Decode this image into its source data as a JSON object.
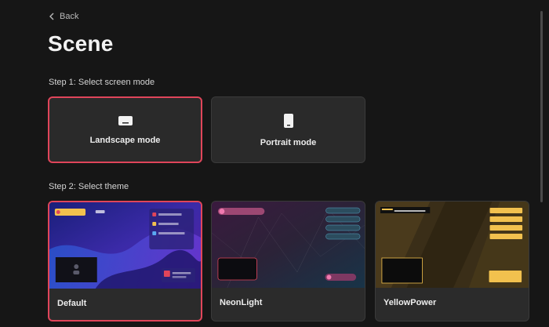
{
  "nav": {
    "back_label": "Back"
  },
  "page": {
    "title": "Scene"
  },
  "steps": {
    "step1_label": "Step 1: Select screen mode",
    "step2_label": "Step 2: Select theme"
  },
  "screen_modes": [
    {
      "label": "Landscape mode",
      "icon": "landscape-device-icon",
      "selected": true
    },
    {
      "label": "Portrait mode",
      "icon": "portrait-device-icon",
      "selected": false
    }
  ],
  "themes": [
    {
      "name": "Default",
      "selected": true
    },
    {
      "name": "NeonLight",
      "selected": false
    },
    {
      "name": "YellowPower",
      "selected": false
    }
  ],
  "colors": {
    "background": "#161616",
    "card": "#2a2a2a",
    "selected_border": "#e0455a",
    "text": "#ededed"
  }
}
